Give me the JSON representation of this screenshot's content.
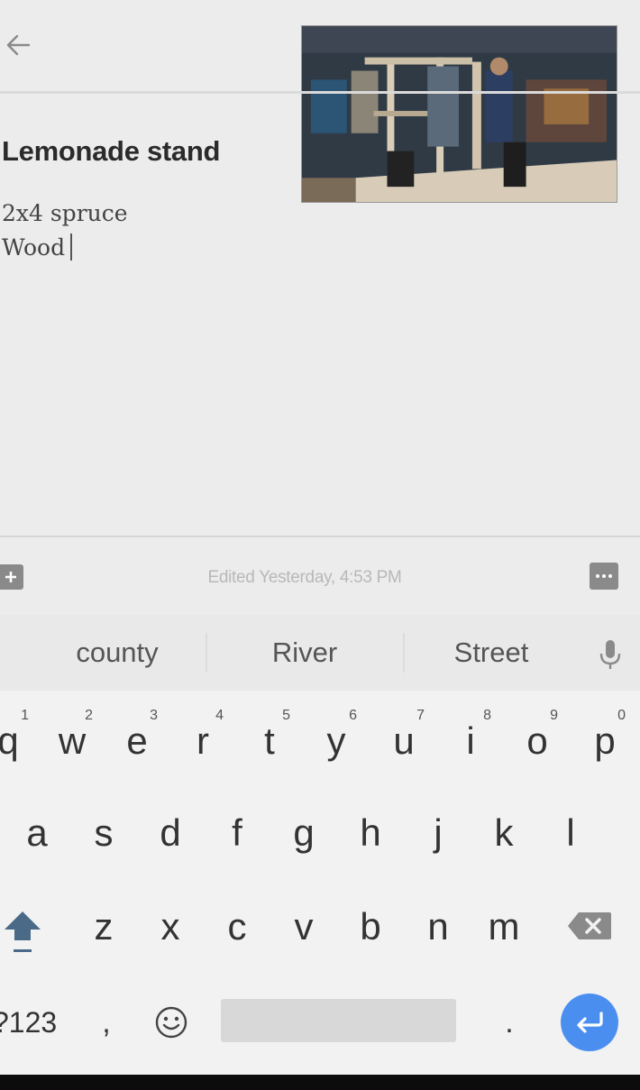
{
  "note": {
    "title": "Lemonade stand",
    "lines": [
      "2x4 spruce",
      "Wood"
    ]
  },
  "footer": {
    "edited_text": "Edited Yesterday, 4:53 PM"
  },
  "icons": {
    "back": "arrow-left-icon",
    "add": "plus-box-icon",
    "more": "more-dots-icon",
    "mic": "microphone-icon",
    "shift": "shift-arrow-icon",
    "backspace": "backspace-icon",
    "emoji": "smiley-icon",
    "enter": "return-arrow-icon"
  },
  "keyboard": {
    "suggestions": [
      "county",
      "River",
      "Street"
    ],
    "row1": [
      {
        "key": "q",
        "hint": "1"
      },
      {
        "key": "w",
        "hint": "2"
      },
      {
        "key": "e",
        "hint": "3"
      },
      {
        "key": "r",
        "hint": "4"
      },
      {
        "key": "t",
        "hint": "5"
      },
      {
        "key": "y",
        "hint": "6"
      },
      {
        "key": "u",
        "hint": "7"
      },
      {
        "key": "i",
        "hint": "8"
      },
      {
        "key": "o",
        "hint": "9"
      },
      {
        "key": "p",
        "hint": "0"
      }
    ],
    "row2": [
      "a",
      "s",
      "d",
      "f",
      "g",
      "h",
      "j",
      "k",
      "l"
    ],
    "row3": [
      "z",
      "x",
      "c",
      "v",
      "b",
      "n",
      "m"
    ],
    "symbols_label": "?123",
    "comma_label": ",",
    "period_label": "."
  },
  "colors": {
    "background": "#ececec",
    "enter_button": "#4a8ff0",
    "icon_gray": "#8a8a8a"
  }
}
